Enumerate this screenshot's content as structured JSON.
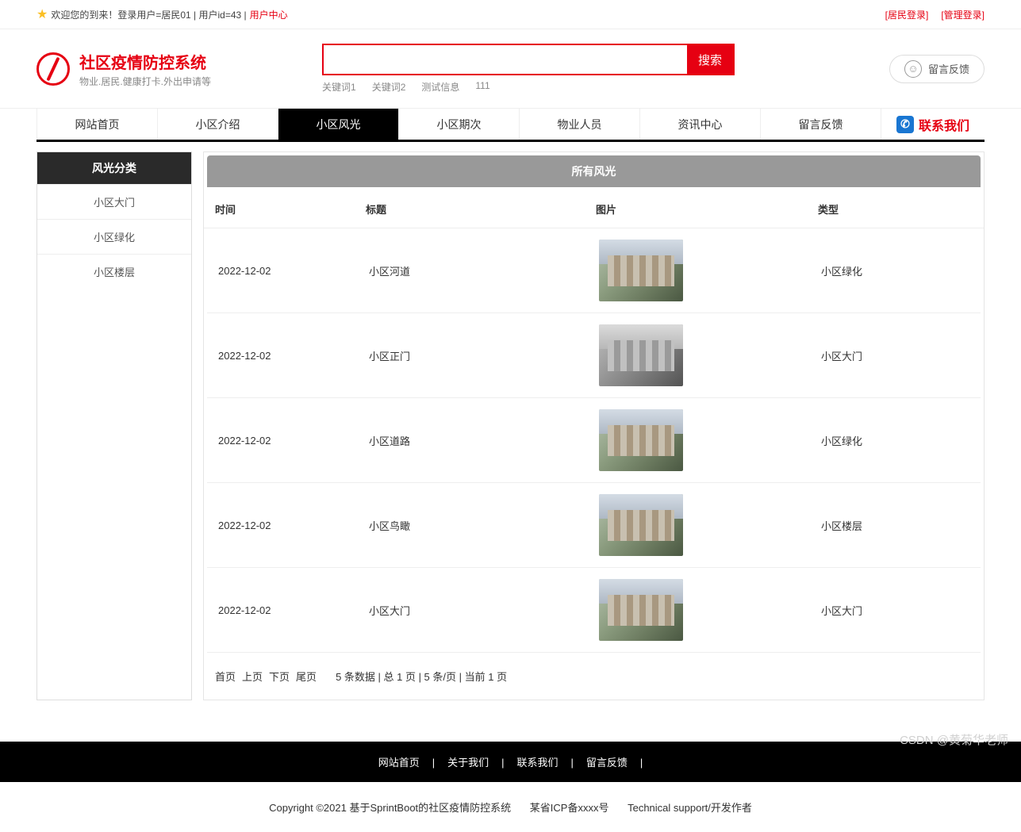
{
  "topbar": {
    "welcome": "欢迎您的到来！登录用户=居民01 | 用户id=43 | ",
    "user_center": "用户中心",
    "resident_login": "[居民登录]",
    "admin_login": "[管理登录]"
  },
  "brand": {
    "title": "社区疫情防控系统",
    "subtitle": "物业.居民.健康打卡.外出申请等"
  },
  "search": {
    "button": "搜索",
    "keywords": [
      "关键词1",
      "关键词2",
      "测试信息",
      "111"
    ]
  },
  "feedback": {
    "label": "留言反馈"
  },
  "nav": {
    "items": [
      "网站首页",
      "小区介绍",
      "小区风光",
      "小区期次",
      "物业人员",
      "资讯中心",
      "留言反馈"
    ],
    "active_index": 2,
    "contact": "联系我们"
  },
  "sidebar": {
    "header": "风光分类",
    "items": [
      "小区大门",
      "小区绿化",
      "小区楼层"
    ]
  },
  "main": {
    "header": "所有风光",
    "columns": {
      "time": "时间",
      "title": "标题",
      "image": "图片",
      "type": "类型"
    },
    "rows": [
      {
        "time": "2022-12-02",
        "title": "小区河道",
        "type": "小区绿化",
        "gray": false
      },
      {
        "time": "2022-12-02",
        "title": "小区正门",
        "type": "小区大门",
        "gray": true
      },
      {
        "time": "2022-12-02",
        "title": "小区道路",
        "type": "小区绿化",
        "gray": false
      },
      {
        "time": "2022-12-02",
        "title": "小区鸟瞰",
        "type": "小区楼层",
        "gray": false
      },
      {
        "time": "2022-12-02",
        "title": "小区大门",
        "type": "小区大门",
        "gray": false
      }
    ]
  },
  "pagination": {
    "first": "首页",
    "prev": "上页",
    "next": "下页",
    "last": "尾页",
    "info": "5 条数据 | 总 1 页 | 5 条/页 | 当前 1 页"
  },
  "footer": {
    "links": [
      "网站首页",
      "关于我们",
      "联系我们",
      "留言反馈"
    ],
    "sep": "|",
    "copy_prefix": "Copyright ©2021 基于SprintBoot的社区疫情防控系统",
    "icp": "某省ICP备xxxx号",
    "tech": "Technical support/开发作者"
  },
  "watermark": "CSDN @黄菊华老师"
}
